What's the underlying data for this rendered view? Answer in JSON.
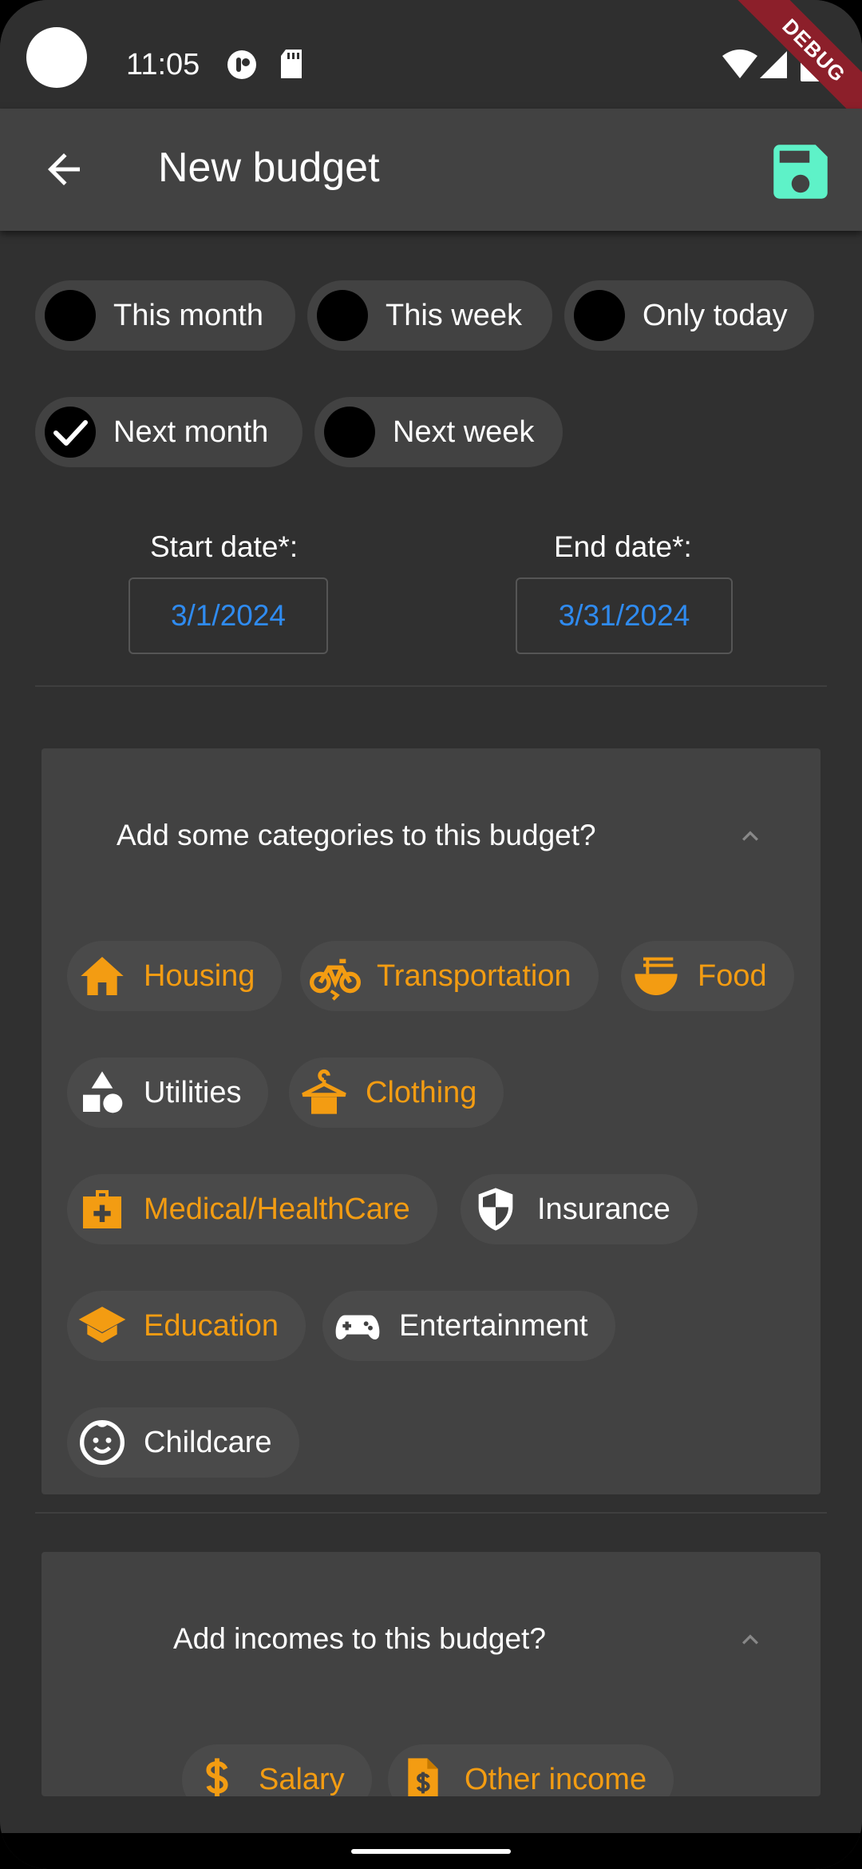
{
  "status": {
    "time": "11:05",
    "debug_banner": "DEBUG"
  },
  "appbar": {
    "title": "New budget"
  },
  "presets": [
    {
      "label": "This month",
      "checked": false
    },
    {
      "label": "This week",
      "checked": false
    },
    {
      "label": "Only today",
      "checked": false
    },
    {
      "label": "Next month",
      "checked": true
    },
    {
      "label": "Next week",
      "checked": false
    }
  ],
  "dates": {
    "start_label": "Start date*:",
    "start_value": "3/1/2024",
    "end_label": "End date*:",
    "end_value": "3/31/2024"
  },
  "categories_panel": {
    "title": "Add some categories to this budget?",
    "items": [
      {
        "label": "Housing",
        "icon": "house-icon",
        "selected": true
      },
      {
        "label": "Transportation",
        "icon": "bicycle-icon",
        "selected": true
      },
      {
        "label": "Food",
        "icon": "noodle-bowl-icon",
        "selected": true
      },
      {
        "label": "Utilities",
        "icon": "shapes-icon",
        "selected": false
      },
      {
        "label": "Clothing",
        "icon": "hanger-icon",
        "selected": true
      },
      {
        "label": "Medical/HealthCare",
        "icon": "medical-bag-icon",
        "selected": true
      },
      {
        "label": "Insurance",
        "icon": "shield-icon",
        "selected": false
      },
      {
        "label": "Education",
        "icon": "graduation-cap-icon",
        "selected": true
      },
      {
        "label": "Entertainment",
        "icon": "gamepad-icon",
        "selected": false
      },
      {
        "label": "Childcare",
        "icon": "baby-face-icon",
        "selected": false
      }
    ]
  },
  "incomes_panel": {
    "title": "Add incomes to this budget?",
    "items": [
      {
        "label": "Salary",
        "icon": "dollar-icon",
        "selected": true
      },
      {
        "label": "Other income",
        "icon": "invoice-dollar-icon",
        "selected": true
      }
    ]
  },
  "colors": {
    "accent": "#f39c12",
    "save": "#5ef2c8",
    "date_text": "#2f8bf0",
    "background": "#303030",
    "surface": "#424242"
  }
}
